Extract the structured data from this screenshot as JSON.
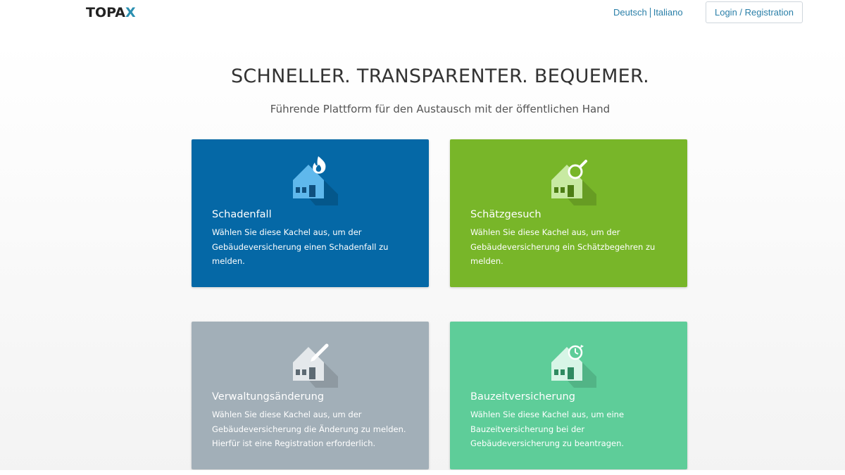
{
  "header": {
    "logo": {
      "text": "TOPA",
      "accent": "X"
    },
    "languages": [
      "Deutsch",
      "Italiano"
    ],
    "login_label": "Login / Registration"
  },
  "hero": {
    "title": "SCHNELLER. TRANSPARENTER. BEQUEMER.",
    "subtitle": "Führende Plattform für den Austausch mit der öffentlichen Hand"
  },
  "tiles": [
    {
      "title": "Schadenfall",
      "description": "Wählen Sie diese Kachel aus, um der Gebäudeversicherung einen Schadenfall zu melden.",
      "color": "#0568a6",
      "icon": "house-fire-icon"
    },
    {
      "title": "Schätzgesuch",
      "description": "Wählen Sie diese Kachel aus, um der Gebäudeversicherung ein Schätzbegehren zu melden.",
      "color": "#78b629",
      "icon": "house-magnifier-icon"
    },
    {
      "title": "Verwaltungsänderung",
      "description": "Wählen Sie diese Kachel aus, um der Gebäudeversicherung die Änderung zu melden. Hierfür ist eine Registration erforderlich.",
      "color": "#a2afb8",
      "icon": "house-pen-icon"
    },
    {
      "title": "Bauzeitversicherung",
      "description": "Wählen Sie diese Kachel aus, um eine Bauzeitversicherung bei der Gebäudeversicherung zu beantragen.",
      "color": "#5ecd99",
      "icon": "house-clock-icon"
    }
  ]
}
